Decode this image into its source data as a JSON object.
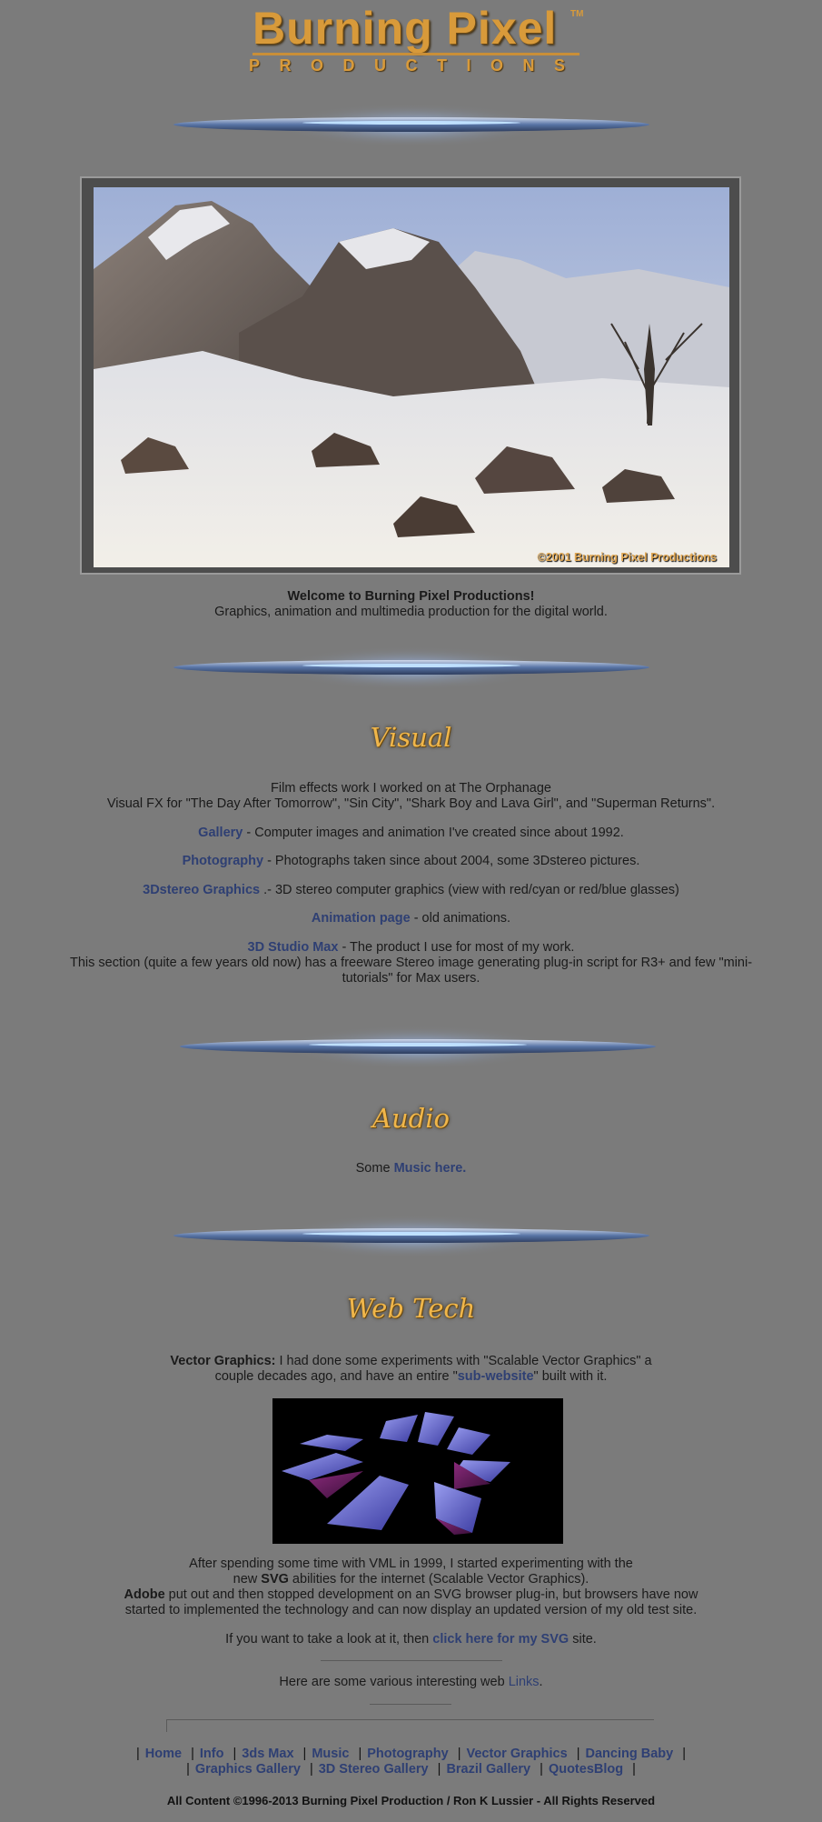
{
  "logo": {
    "title": "Burning Pixel",
    "tm": "TM",
    "subtitle": "PRODUCTIONS"
  },
  "hero": {
    "copyright": "©2001 Burning Pixel Productions"
  },
  "welcome": {
    "title": "Welcome to Burning Pixel Productions!",
    "tagline": "Graphics, animation and multimedia production for the digital world."
  },
  "visual": {
    "heading": "Visual",
    "intro_1": "Film effects work I worked on at The Orphanage",
    "intro_2": "Visual FX for \"The Day After Tomorrow\", \"Sin City\", \"Shark Boy and Lava Girl\", and \"Superman Returns\".",
    "items": [
      {
        "link": "Gallery",
        "text": " - Computer images and animation I've created since about 1992."
      },
      {
        "link": "Photography",
        "text": " - Photographs taken since about 2004, some 3Dstereo pictures."
      },
      {
        "link": "3Dstereo Graphics ",
        "text": ".- 3D stereo computer graphics (view with red/cyan or red/blue glasses)"
      },
      {
        "link": "Animation page",
        "text": " - old animations."
      },
      {
        "link": "3D Studio Max",
        "text": " - The product I use for most of my work."
      }
    ],
    "max_note": "This section (quite a few years old now) has a freeware Stereo image generating plug-in script for R3+ and few \"mini-tutorials\" for Max users."
  },
  "audio": {
    "heading": "Audio",
    "prefix": "Some ",
    "link": "Music here."
  },
  "webtech": {
    "heading": "Web Tech",
    "vg_label": "Vector Graphics:",
    "vg_text_1": "  I had done some experiments with \"Scalable Vector Graphics\" a",
    "vg_text_2a": "couple decades ago, and have an entire \"",
    "vg_link": "sub-website",
    "vg_text_2b": "\" built with it.",
    "p1_line1": "After spending some time with VML in 1999, I started experimenting with the",
    "p1_line2a": "new ",
    "p1_svg": "SVG",
    "p1_line2b": " abilities for the internet (Scalable Vector Graphics).",
    "p1_adobe": "Adobe",
    "p1_line3": " put out and then stopped development on an SVG browser plug-in, but browsers have now",
    "p1_line4": "started to implemented the technology and can now display an updated version of my old test site.",
    "p2_prefix": "If you want to take a look at it, then ",
    "p2_link": "click here for my SVG",
    "p2_suffix": " site.",
    "p3_prefix": "Here are some various interesting web ",
    "p3_link": "Links",
    "p3_suffix": "."
  },
  "footer_nav": {
    "row1": [
      "Home",
      "Info",
      "3ds Max",
      "Music",
      "Photography",
      "Vector Graphics",
      "Dancing Baby"
    ],
    "row2": [
      "Graphics Gallery",
      "3D Stereo Gallery",
      "Brazil Gallery",
      "QuotesBlog"
    ],
    "copyright": "All Content ©1996-2013 Burning Pixel Production / Ron K Lussier - All Rights Reserved"
  },
  "colors": {
    "background": "#7b7b7b",
    "link": "#2e3f73",
    "heading": "#f0b64a"
  }
}
